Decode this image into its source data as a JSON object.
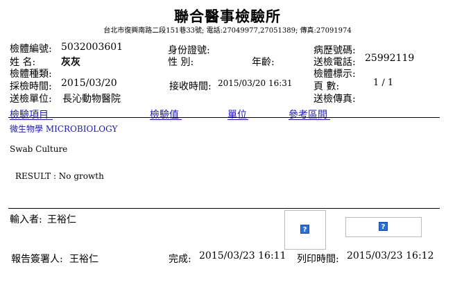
{
  "header": {
    "title": "聯合醫事檢驗所",
    "address": "台北市復興南路二段151巷33號; 電話:27049977,27051389; 傳真:27091974"
  },
  "patient": {
    "specimen_no_label": "檢體編號:",
    "specimen_no": "5032003601",
    "name_label": "姓  名:",
    "name": "灰灰",
    "specimen_type_label": "檢體種類:",
    "collect_time_label": "採檢時間:",
    "collect_time": "2015/03/20",
    "sender_label": "送檢單位:",
    "sender": "長沁動物醫院",
    "id_label": "身份證號:",
    "sex_label": "性  別:",
    "age_label": "年齡:",
    "receive_time_label": "接收時間:",
    "receive_time": "2015/03/20 16:31",
    "history_no_label": "病歷號碼:",
    "phone_label": "送檢電話:",
    "phone": "25992119",
    "specimen_tag_label": "檢體標示:",
    "page_label": "頁  數:",
    "page": "1 / 1",
    "fax_label": "送檢傳真:"
  },
  "columns": {
    "item": "檢驗項目",
    "value": "檢驗值",
    "unit": "單位",
    "reference": "參考區間"
  },
  "results": {
    "section": "微生物學 MICROBIOLOGY",
    "test": "Swab Culture",
    "result": "RESULT : No growth"
  },
  "footer": {
    "entered_by_label": "輸入者:",
    "entered_by": "王裕仁",
    "signer_label": "報告簽署人:",
    "signer": "王裕仁",
    "complete_label": "完成:",
    "complete_time": "2015/03/23 16:11",
    "print_label": "列印時間:",
    "print_time": "2015/03/23 16:12",
    "image_placeholder": "?"
  }
}
